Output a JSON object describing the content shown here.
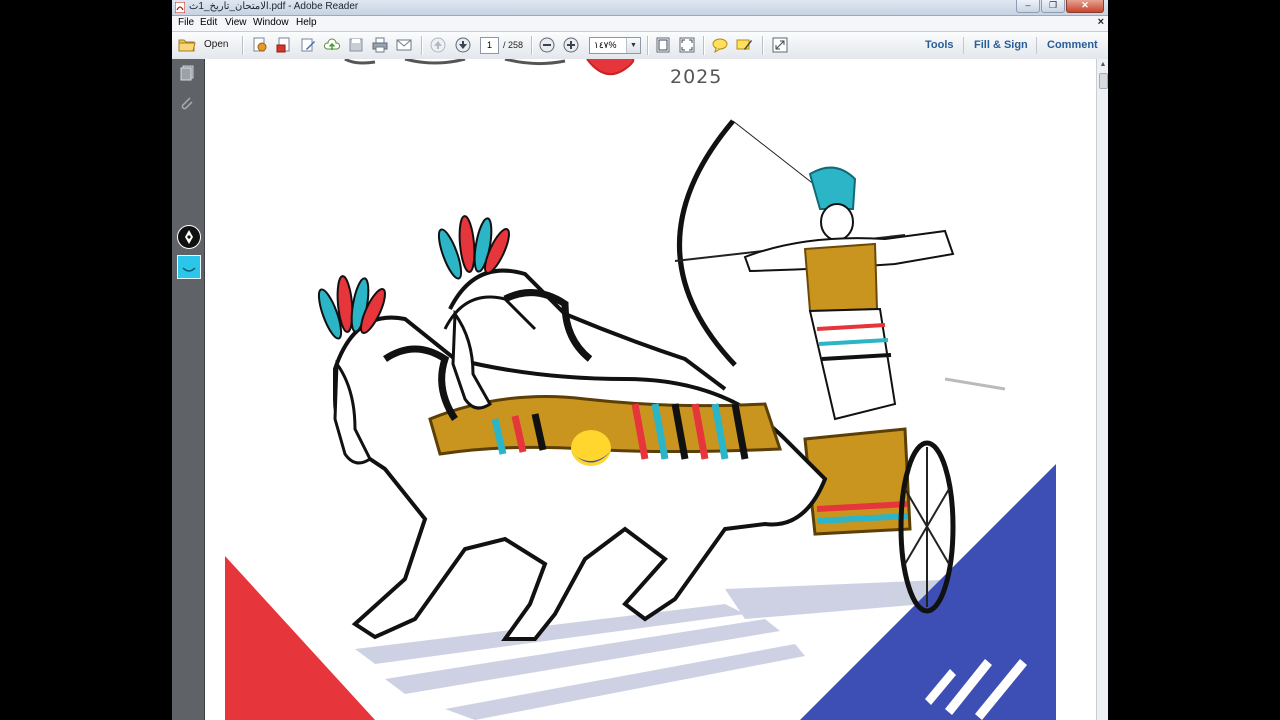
{
  "window": {
    "title": "الامتحان_تاريخ_1ث.pdf - Adobe Reader",
    "controls": [
      "minimize",
      "maximize",
      "close"
    ]
  },
  "menubar": {
    "items": [
      "File",
      "Edit",
      "View",
      "Window",
      "Help"
    ],
    "doc_close": "×"
  },
  "toolbar": {
    "open_label": "Open",
    "page_current": "1",
    "page_total": "/ 258",
    "zoom": "١٤٧%",
    "links": [
      "Tools",
      "Fill & Sign",
      "Comment"
    ]
  },
  "navpane": {
    "icons": [
      "pages-panel-icon",
      "attachments-icon",
      "pen-tool-icon",
      "shape-tool-icon"
    ]
  },
  "document": {
    "year": "2025",
    "cover_colors": {
      "red": "#e6353b",
      "blue": "#3d4fb5",
      "cyan": "#2bb5c7",
      "gold": "#c9951e"
    }
  }
}
